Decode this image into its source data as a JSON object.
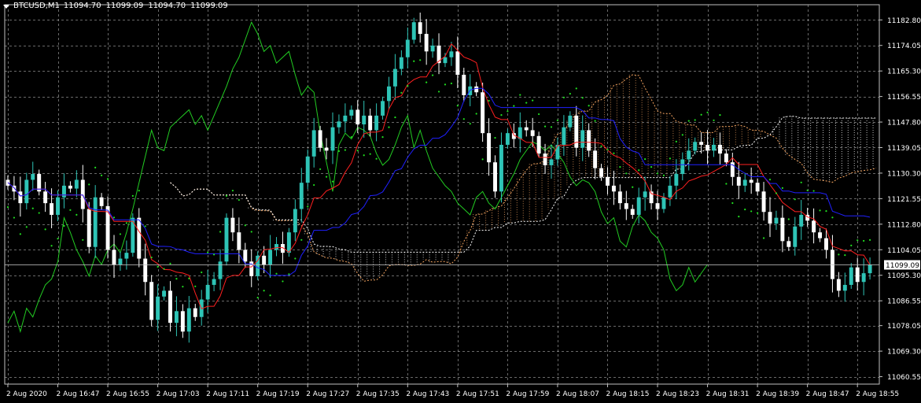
{
  "header": {
    "symbol": "BTCUSD,M1",
    "open": "11094.70",
    "high": "11099.09",
    "low": "11094.70",
    "close": "11099.09"
  },
  "colors": {
    "background": "#000000",
    "grid": "#c0c0c0",
    "bull_candle": "#2ec4b6",
    "bear_candle": "#ffffff",
    "tenkan": "#ff2020",
    "kijun": "#2020ff",
    "chikou": "#22cc22",
    "senkou_a": "#f4a460",
    "senkou_b": "#ffffff",
    "parabolic_sar": "#20e020",
    "bid_line": "#c0c0c0",
    "axis_text": "#ffffff"
  },
  "chart_data": {
    "type": "candlestick",
    "symbol": "BTCUSD",
    "timeframe": "M1",
    "indicators": [
      "Ichimoku Kinko Hyo",
      "Parabolic SAR"
    ],
    "current_price": 11099.09,
    "current_price_label": "11099.09",
    "ylim": [
      11058,
      11188
    ],
    "y_ticks": [
      11182.8,
      11174.05,
      11165.3,
      11156.55,
      11147.8,
      11139.05,
      11130.3,
      11121.55,
      11112.8,
      11104.05,
      11095.3,
      11086.55,
      11078.05,
      11069.3,
      11060.55
    ],
    "y_tick_labels": [
      "11182.80",
      "11174.05",
      "11165.30",
      "11156.55",
      "11147.80",
      "11139.05",
      "11130.30",
      "11121.55",
      "11112.80",
      "11104.05",
      "11095.30",
      "11086.55",
      "11078.05",
      "11069.30",
      "11060.55"
    ],
    "x_tick_labels": [
      "2 Aug 2020",
      "2 Aug 16:47",
      "2 Aug 16:55",
      "2 Aug 17:03",
      "2 Aug 17:11",
      "2 Aug 17:19",
      "2 Aug 17:27",
      "2 Aug 17:35",
      "2 Aug 17:43",
      "2 Aug 17:51",
      "2 Aug 17:59",
      "2 Aug 18:07",
      "2 Aug 18:15",
      "2 Aug 18:23",
      "2 Aug 18:31",
      "2 Aug 18:39",
      "2 Aug 18:47",
      "2 Aug 18:55"
    ],
    "x_tick_index": [
      0,
      8,
      16,
      24,
      32,
      40,
      48,
      56,
      64,
      72,
      80,
      88,
      96,
      104,
      112,
      120,
      128,
      136
    ],
    "grid": true,
    "close_path": [
      11126,
      11124,
      11120,
      11128,
      11130,
      11124,
      11120,
      11116,
      11122,
      11126,
      11125,
      11128,
      11118,
      11105,
      11122,
      11119,
      11104,
      11099,
      11101,
      11103,
      11115,
      11101,
      11093,
      11080,
      11088,
      11090,
      11079,
      11083,
      11076,
      11084,
      11081,
      11087,
      11092,
      11094,
      11100,
      11115,
      11110,
      11104,
      11100,
      11095,
      11102,
      11099,
      11104,
      11106,
      11103,
      11110,
      11118,
      11127,
      11136,
      11145,
      11139,
      11138,
      11146,
      11148,
      11150,
      11152,
      11147,
      11150,
      11145,
      11150,
      11155,
      11160,
      11166,
      11170,
      11176,
      11182,
      11178,
      11172,
      11174,
      11168,
      11170,
      11172,
      11164,
      11157,
      11160,
      11158,
      11144,
      11134,
      11124,
      11140,
      11144,
      11142,
      11146,
      11145,
      11143,
      11137,
      11133,
      11135,
      11140,
      11146,
      11150,
      11139,
      11145,
      11138,
      11132,
      11129,
      11126,
      11124,
      11120,
      11118,
      11116,
      11122,
      11124,
      11120,
      11118,
      11122,
      11126,
      11130,
      11135,
      11138,
      11141,
      11140,
      11138,
      11140,
      11137,
      11134,
      11129,
      11126,
      11128,
      11127,
      11124,
      11117,
      11113,
      11115,
      11107,
      11105,
      11112,
      11116,
      11114,
      11110,
      11108,
      11104,
      11094,
      11090,
      11092,
      11098,
      11093,
      11096,
      11099
    ]
  }
}
